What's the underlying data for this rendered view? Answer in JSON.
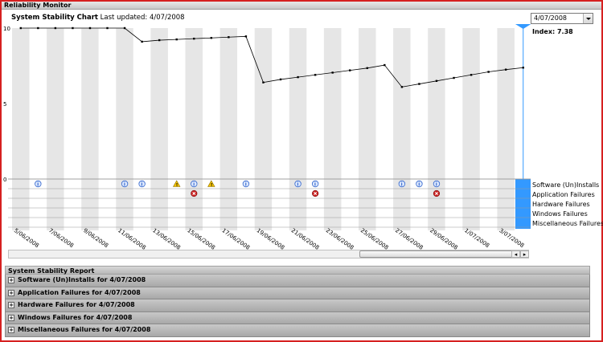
{
  "window": {
    "title": "Reliability Monitor"
  },
  "chart_header": {
    "title": "System Stability Chart",
    "updated_label": "Last updated: 4/07/2008"
  },
  "date_select": {
    "value": "4/07/2008"
  },
  "index": {
    "label": "Index: 7.38"
  },
  "y_axis": {
    "ticks": [
      "10",
      "5",
      "0"
    ]
  },
  "categories": [
    "Software (Un)Installs",
    "Application Failures",
    "Hardware Failures",
    "Windows Failures",
    "Miscellaneous Failures"
  ],
  "colors": {
    "selected": "#3399ff",
    "error": "#cc2222",
    "warning": "#f5c400",
    "info": "#3366cc"
  },
  "chart_data": {
    "type": "line",
    "ylim": [
      0,
      10
    ],
    "x": [
      "5/06/2008",
      "6/06/2008",
      "7/06/2008",
      "8/06/2008",
      "9/06/2008",
      "10/06/2008",
      "11/06/2008",
      "12/06/2008",
      "13/06/2008",
      "14/06/2008",
      "15/06/2008",
      "16/06/2008",
      "17/06/2008",
      "18/06/2008",
      "19/06/2008",
      "20/06/2008",
      "21/06/2008",
      "22/06/2008",
      "23/06/2008",
      "24/06/2008",
      "25/06/2008",
      "26/06/2008",
      "27/06/2008",
      "28/06/2008",
      "29/06/2008",
      "30/06/2008",
      "1/07/2008",
      "2/07/2008",
      "3/07/2008",
      "4/07/2008"
    ],
    "x_tick_labels": [
      "5/06/2008",
      "7/06/2008",
      "9/06/2008",
      "11/06/2008",
      "13/06/2008",
      "15/06/2008",
      "17/06/2008",
      "19/06/2008",
      "21/06/2008",
      "23/06/2008",
      "25/06/2008",
      "27/06/2008",
      "29/06/2008",
      "1/07/2008",
      "3/07/2008"
    ],
    "values": [
      10,
      10,
      10,
      10,
      10,
      10,
      10,
      10,
      10,
      10,
      9.1,
      9.2,
      9.25,
      9.3,
      9.35,
      9.4,
      9.45,
      6.4,
      6.6,
      6.75,
      6.9,
      7.05,
      7.2,
      7.35,
      7.55,
      6.1,
      6.3,
      6.5,
      6.7,
      6.9,
      7.1,
      7.25,
      7.38
    ],
    "values_note_free": true,
    "events": [
      {
        "day": "6/06/2008",
        "category": "Software (Un)Installs",
        "kind": "info"
      },
      {
        "day": "11/06/2008",
        "category": "Software (Un)Installs",
        "kind": "info"
      },
      {
        "day": "12/06/2008",
        "category": "Software (Un)Installs",
        "kind": "info"
      },
      {
        "day": "14/06/2008",
        "category": "Software (Un)Installs",
        "kind": "warning"
      },
      {
        "day": "15/06/2008",
        "category": "Software (Un)Installs",
        "kind": "info"
      },
      {
        "day": "16/06/2008",
        "category": "Software (Un)Installs",
        "kind": "warning"
      },
      {
        "day": "18/06/2008",
        "category": "Software (Un)Installs",
        "kind": "info"
      },
      {
        "day": "21/06/2008",
        "category": "Software (Un)Installs",
        "kind": "info"
      },
      {
        "day": "22/06/2008",
        "category": "Software (Un)Installs",
        "kind": "info"
      },
      {
        "day": "27/06/2008",
        "category": "Software (Un)Installs",
        "kind": "info"
      },
      {
        "day": "28/06/2008",
        "category": "Software (Un)Installs",
        "kind": "info"
      },
      {
        "day": "29/06/2008",
        "category": "Software (Un)Installs",
        "kind": "info"
      },
      {
        "day": "15/06/2008",
        "category": "Application Failures",
        "kind": "error"
      },
      {
        "day": "22/06/2008",
        "category": "Application Failures",
        "kind": "error"
      },
      {
        "day": "29/06/2008",
        "category": "Application Failures",
        "kind": "error"
      }
    ]
  },
  "scrollbar": {
    "left_arrow": "◂",
    "right_arrow": "▸"
  },
  "report": {
    "title": "System Stability Report",
    "expand_symbol": "+",
    "rows": [
      "Software (Un)Installs for 4/07/2008",
      "Application Failures for 4/07/2008",
      "Hardware Failures for 4/07/2008",
      "Windows Failures for 4/07/2008",
      "Miscellaneous Failures for 4/07/2008"
    ]
  }
}
